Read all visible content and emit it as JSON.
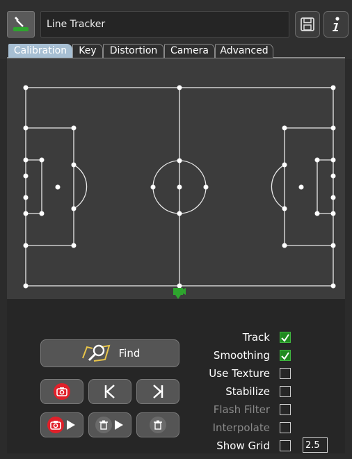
{
  "header": {
    "title": "Line Tracker",
    "icons": {
      "app": "line-tracker-app-icon",
      "save": "save-icon",
      "info": "info-icon"
    }
  },
  "tabs": [
    {
      "label": "Calibration",
      "active": true
    },
    {
      "label": "Key",
      "active": false
    },
    {
      "label": "Distortion",
      "active": false
    },
    {
      "label": "Camera",
      "active": false
    },
    {
      "label": "Advanced",
      "active": false
    }
  ],
  "actions": {
    "find_label": "Find",
    "icons": [
      "find-icon",
      "camera-icon",
      "previous-key-icon",
      "next-key-icon",
      "record-play-icon",
      "delete-play-icon",
      "delete-icon"
    ]
  },
  "options": [
    {
      "label": "Track",
      "checked": true,
      "enabled": true
    },
    {
      "label": "Smoothing",
      "checked": true,
      "enabled": true
    },
    {
      "label": "Use Texture",
      "checked": false,
      "enabled": true
    },
    {
      "label": "Stabilize",
      "checked": false,
      "enabled": true
    },
    {
      "label": "Flash Filter",
      "checked": false,
      "enabled": false
    },
    {
      "label": "Interpolate",
      "checked": false,
      "enabled": false
    },
    {
      "label": "Show Grid",
      "checked": false,
      "enabled": true
    }
  ],
  "grid_size": "2.5",
  "colors": {
    "accent_green": "#2ea52e",
    "active_tab": "#a7bfd3",
    "record_red": "#e0202a"
  }
}
